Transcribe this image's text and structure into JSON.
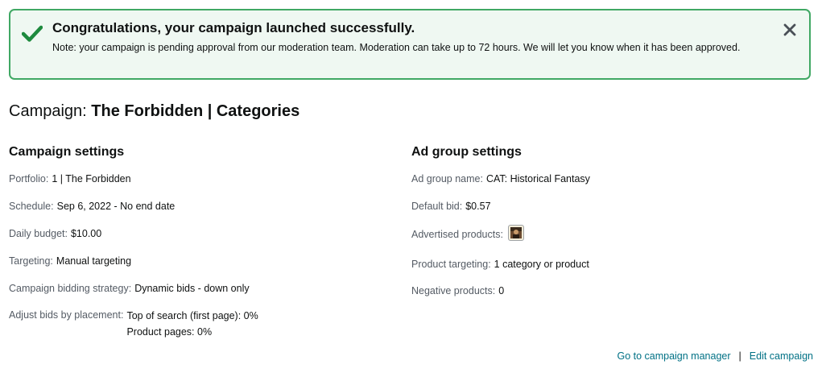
{
  "alert": {
    "icon": "check-icon",
    "title": "Congratulations, your campaign launched successfully.",
    "note": "Note: your campaign is pending approval from our moderation team. Moderation can take up to 72 hours. We will let you know when it has been approved.",
    "close_icon": "close-icon",
    "accent_color": "#40a864"
  },
  "campaign": {
    "prefix": "Campaign: ",
    "name": "The Forbidden | Categories"
  },
  "campaign_settings": {
    "heading": "Campaign settings",
    "rows": [
      {
        "label": "Portfolio:",
        "value": "1 | The Forbidden"
      },
      {
        "label": "Schedule:",
        "value": "Sep 6, 2022 - No end date"
      },
      {
        "label": "Daily budget:",
        "value": "$10.00"
      },
      {
        "label": "Targeting:",
        "value": "Manual targeting"
      },
      {
        "label": "Campaign bidding strategy:",
        "value": "Dynamic bids - down only"
      },
      {
        "label": "Adjust bids by placement:",
        "values": [
          "Top of search (first page): 0%",
          "Product pages: 0%"
        ]
      }
    ]
  },
  "ad_group_settings": {
    "heading": "Ad group settings",
    "rows": [
      {
        "label": "Ad group name:",
        "value": "CAT: Historical Fantasy"
      },
      {
        "label": "Default bid:",
        "value": "$0.57"
      },
      {
        "label": "Advertised products:",
        "thumbnail": "book-cover-thumbnail"
      },
      {
        "label": "Product targeting:",
        "value": "1 category or product"
      },
      {
        "label": "Negative products:",
        "value": "0"
      }
    ]
  },
  "footer": {
    "go_to_manager": "Go to campaign manager",
    "separator": "|",
    "edit_campaign": "Edit campaign",
    "link_color": "#007185"
  }
}
